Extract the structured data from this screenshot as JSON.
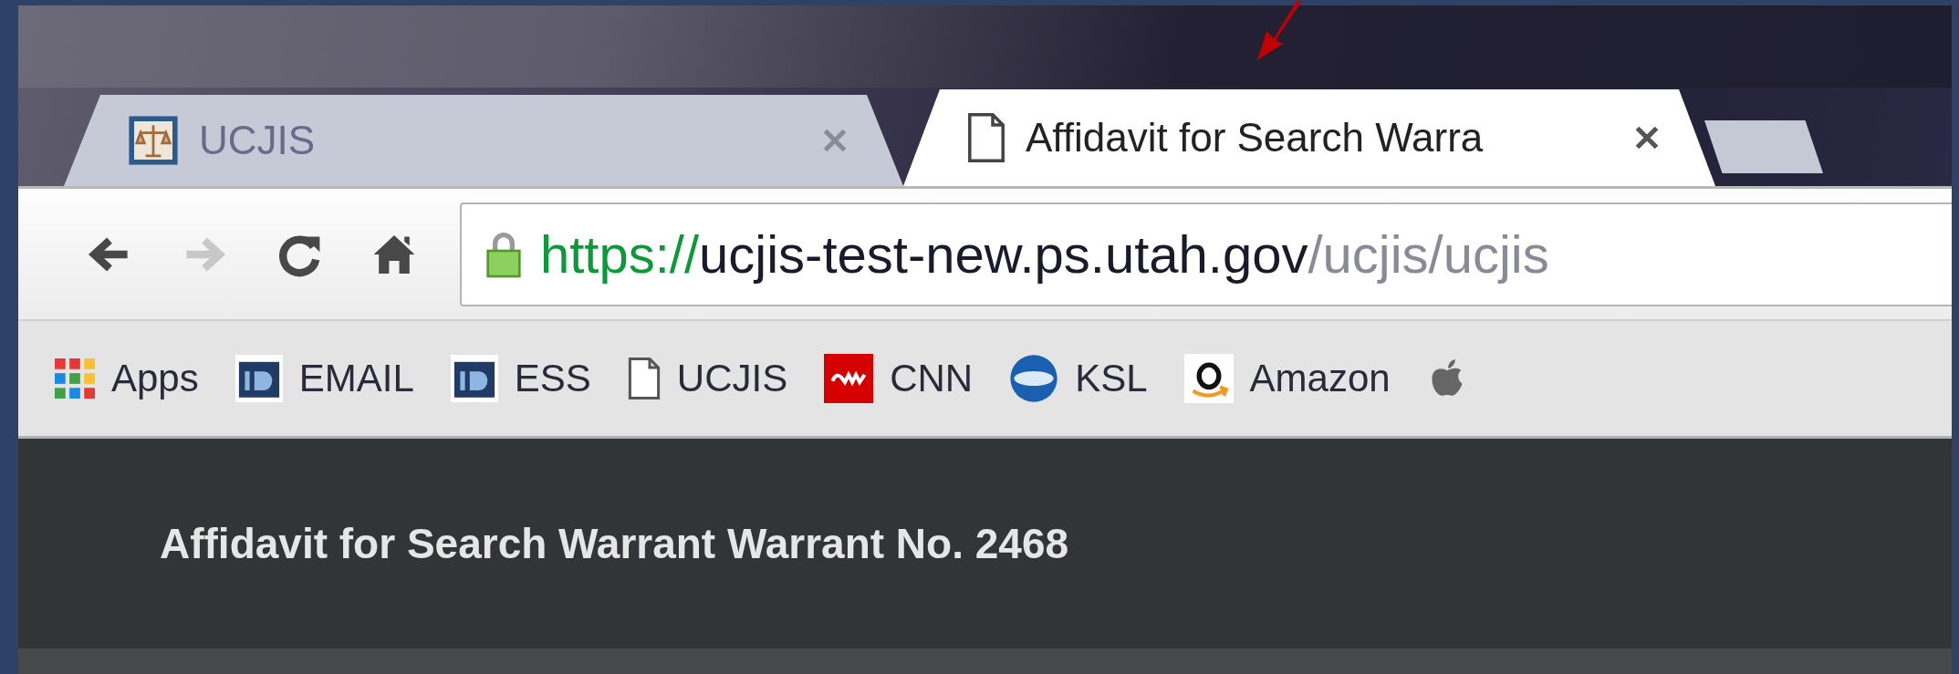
{
  "tabs": [
    {
      "title": "UCJIS",
      "kind": "scales",
      "selected": false
    },
    {
      "title": "Affidavit for Search Warra",
      "kind": "page",
      "selected": true
    }
  ],
  "nav_buttons": [
    {
      "kind": "back",
      "disabled": false
    },
    {
      "kind": "forward",
      "disabled": true
    },
    {
      "kind": "reload",
      "disabled": false
    },
    {
      "kind": "home",
      "disabled": false
    }
  ],
  "address_bar": {
    "secure": true,
    "url_parts": [
      {
        "kind": "scheme",
        "text": "https://"
      },
      {
        "kind": "host",
        "text": "ucjis-test-new.ps.utah.gov"
      },
      {
        "kind": "path",
        "text": "/ucjis/ucjis"
      }
    ]
  },
  "bookmarks": [
    {
      "kind": "apps",
      "label": "Apps"
    },
    {
      "kind": "id",
      "label": "EMAIL"
    },
    {
      "kind": "id",
      "label": "ESS"
    },
    {
      "kind": "page",
      "label": "UCJIS"
    },
    {
      "kind": "cnn",
      "label": "CNN"
    },
    {
      "kind": "ksl",
      "label": "KSL"
    },
    {
      "kind": "amazon",
      "label": "Amazon"
    },
    {
      "kind": "apple"
    }
  ],
  "page": {
    "title": "Affidavit for Search Warrant Warrant No. 2468"
  }
}
